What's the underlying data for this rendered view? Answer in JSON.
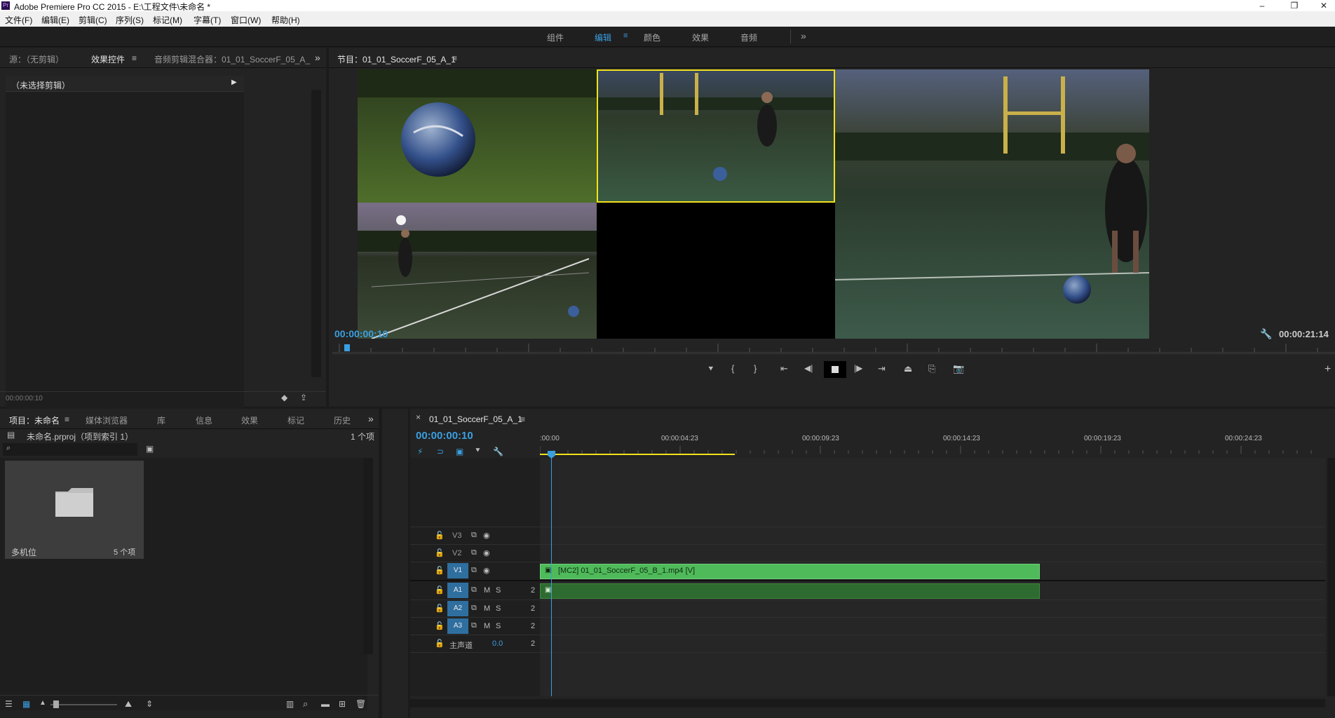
{
  "window": {
    "title": "Adobe Premiere Pro CC 2015 - E:\\工程文件\\未命名 *",
    "app_icon_text": "Pr",
    "controls": [
      "–",
      "❐",
      "✕"
    ]
  },
  "menubar": [
    "文件(F)",
    "编辑(E)",
    "剪辑(C)",
    "序列(S)",
    "标记(M)",
    "字幕(T)",
    "窗口(W)",
    "帮助(H)"
  ],
  "workspaces": {
    "items": [
      "组件",
      "编辑",
      "颜色",
      "效果",
      "音频"
    ],
    "active": "编辑",
    "more": "»"
  },
  "source_panel": {
    "tabs": [
      "源：（无剪辑）",
      "效果控件",
      "音频剪辑混合器：01_01_SoccerF_05_A_"
    ],
    "active_tab": "效果控件",
    "no_clip_label": "（未选择剪辑）",
    "timecode": "00:00:00:10",
    "more": "»"
  },
  "program_monitor": {
    "title": "节目：01_01_SoccerF_05_A_1",
    "current_time": "00:00:00:10",
    "duration": "00:00:21:14",
    "playhead_fraction": 0.015
  },
  "project_panel": {
    "tabs": [
      "项目：未命名",
      "媒体浏览器",
      "库",
      "信息",
      "效果",
      "标记",
      "历史"
    ],
    "active_tab": "项目：未命名",
    "file_name": "未命名.prproj（项到索引 1）",
    "item_count": "1 个项",
    "bin": {
      "name": "多机位",
      "count": "5 个项"
    },
    "more": "»"
  },
  "timeline": {
    "sequence_name": "01_01_SoccerF_05_A_1",
    "current_time": "00:00:00:10",
    "ruler_labels": [
      ":00:00",
      "00:00:04:23",
      "00:00:09:23",
      "00:00:14:23",
      "00:00:19:23",
      "00:00:24:23"
    ],
    "tracks": [
      {
        "name": "V3",
        "type": "video"
      },
      {
        "name": "V2",
        "type": "video"
      },
      {
        "name": "V1",
        "type": "video",
        "target": true
      },
      {
        "name": "A1",
        "type": "audio",
        "target": true
      },
      {
        "name": "A2",
        "type": "audio",
        "target": true
      },
      {
        "name": "A3",
        "type": "audio",
        "target": true
      }
    ],
    "master": {
      "label": "主声道",
      "value": "0.0"
    },
    "audio_m": "M",
    "audio_s": "S",
    "audio_val": "2",
    "clip_label": "[MC2] 01_01_SoccerF_05_B_1.mp4 [V]"
  },
  "colors": {
    "accent_blue": "#3a9fe0",
    "clip_video": "#4fba5a",
    "clip_audio": "#2e6b30",
    "selection_yellow": "#f2e21a"
  }
}
